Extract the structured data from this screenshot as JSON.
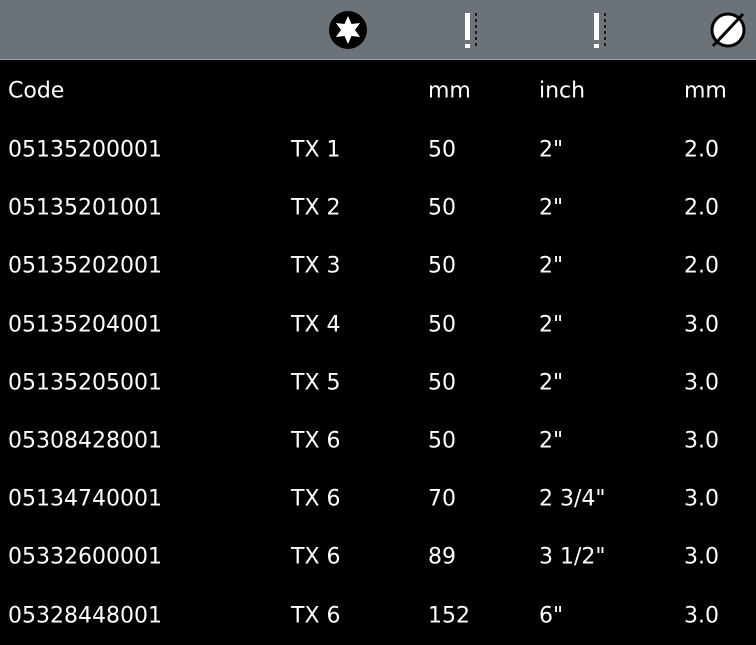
{
  "header": {
    "icons": [
      "torx-star-icon",
      "length-icon",
      "length-icon",
      "diameter-icon"
    ],
    "columns": {
      "code": "Code",
      "size": "",
      "length_mm": "mm",
      "length_inch": "inch",
      "diameter_mm": "mm"
    }
  },
  "rows": [
    {
      "code": "05135200001",
      "size": "TX 1",
      "length_mm": "50",
      "length_inch": "2\"",
      "diameter_mm": "2.0"
    },
    {
      "code": "05135201001",
      "size": "TX 2",
      "length_mm": "50",
      "length_inch": "2\"",
      "diameter_mm": "2.0"
    },
    {
      "code": "05135202001",
      "size": "TX 3",
      "length_mm": "50",
      "length_inch": "2\"",
      "diameter_mm": "2.0"
    },
    {
      "code": "05135204001",
      "size": "TX 4",
      "length_mm": "50",
      "length_inch": "2\"",
      "diameter_mm": "3.0"
    },
    {
      "code": "05135205001",
      "size": "TX 5",
      "length_mm": "50",
      "length_inch": "2\"",
      "diameter_mm": "3.0"
    },
    {
      "code": "05308428001",
      "size": "TX 6",
      "length_mm": "50",
      "length_inch": "2\"",
      "diameter_mm": "3.0"
    },
    {
      "code": "05134740001",
      "size": "TX 6",
      "length_mm": "70",
      "length_inch": "2 3/4\"",
      "diameter_mm": "3.0"
    },
    {
      "code": "05332600001",
      "size": "TX 6",
      "length_mm": "89",
      "length_inch": "3 1/2\"",
      "diameter_mm": "3.0"
    },
    {
      "code": "05328448001",
      "size": "TX 6",
      "length_mm": "152",
      "length_inch": "6\"",
      "diameter_mm": "3.0"
    }
  ],
  "colors": {
    "background": "#000000",
    "icon_bar": "#6b7378",
    "text": "#ffffff"
  }
}
